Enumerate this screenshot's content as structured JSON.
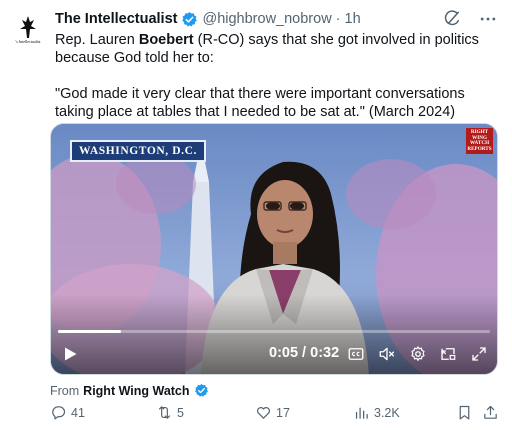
{
  "author": {
    "display_name": "The Intellectualist",
    "handle": "@highbrow_nobrow",
    "separator": "·",
    "time": "1h",
    "avatar_text": "'s Intellectualist"
  },
  "body": {
    "line_before_bold": "Rep. Lauren ",
    "bold_word": "Boebert",
    "line_after_bold": " (R-CO) says that she got involved in politics because God told her to:",
    "quote": "\"God made it very clear that there were important conversations taking place at tables that I needed to be sat at.\" (March 2024)"
  },
  "video": {
    "location_badge": "WASHINGTON, D.C.",
    "watermark_lines": [
      "RIGHT",
      "WING",
      "WATCH",
      "REPORTS"
    ],
    "current_time": "0:05",
    "time_separator": " / ",
    "duration": "0:32",
    "progress_fraction": 0.146
  },
  "source": {
    "from_label": "From",
    "from_name": "Right Wing Watch"
  },
  "actions": {
    "replies": "41",
    "reposts": "5",
    "likes": "17",
    "views": "3.2K"
  },
  "colors": {
    "verified_blue": "#1d9bf0",
    "secondary_text": "#536471",
    "primary_text": "#0f1419",
    "badge_blue": "#1c3d77",
    "logo_red": "#b31b1b"
  },
  "icons": [
    "grok-icon",
    "more-icon",
    "verified-icon",
    "play-icon",
    "captions-icon",
    "mute-icon",
    "settings-icon",
    "pip-icon",
    "fullscreen-icon",
    "reply-icon",
    "repost-icon",
    "like-icon",
    "views-icon",
    "bookmark-icon",
    "share-icon"
  ]
}
